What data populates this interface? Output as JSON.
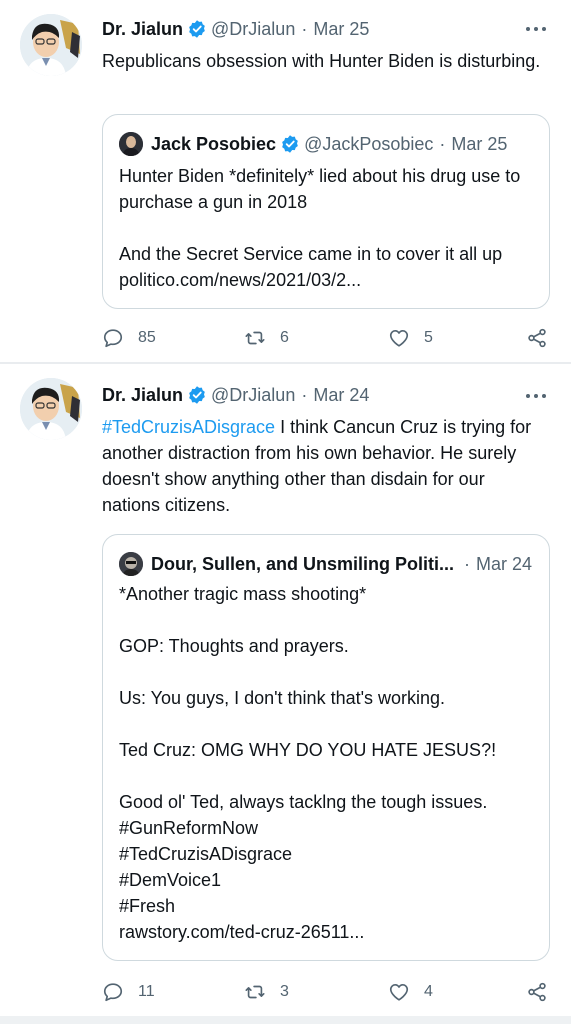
{
  "tweets": [
    {
      "author": {
        "name": "Dr. Jialun",
        "handle": "@DrJialun"
      },
      "date": "Mar 25",
      "text": "Republicans obsession with Hunter Biden is disturbing.",
      "quote": {
        "author": {
          "name": "Jack Posobiec",
          "handle": "@JackPosobiec"
        },
        "date": "Mar 25",
        "text": "Hunter Biden *definitely* lied about his drug use to purchase a gun in 2018\n\nAnd the Secret Service came in to cover it all up\npolitico.com/news/2021/03/2..."
      },
      "stats": {
        "replies": "85",
        "retweets": "6",
        "likes": "5"
      }
    },
    {
      "author": {
        "name": "Dr. Jialun",
        "handle": "@DrJialun"
      },
      "date": "Mar 24",
      "hashtag": "#TedCruzisADisgrace",
      "text": " I think Cancun Cruz is trying for another distraction from his own behavior. He surely doesn't show anything other than disdain for our nations citizens.",
      "quote": {
        "author": {
          "name": "Dour, Sullen, and Unsmiling Politi...",
          "handle": ""
        },
        "date": "Mar 24",
        "text": "*Another tragic mass shooting*\n\nGOP: Thoughts and prayers.\n\nUs: You guys, I don't think that's working.\n\nTed Cruz: OMG WHY DO YOU HATE JESUS?!\n\nGood ol' Ted, always tacklng the tough issues.\n#GunReformNow\n#TedCruzisADisgrace\n#DemVoice1\n#Fresh\nrawstory.com/ted-cruz-26511..."
      },
      "stats": {
        "replies": "11",
        "retweets": "3",
        "likes": "4"
      }
    }
  ],
  "icons": {
    "verified": "verified-badge-icon",
    "more": "more-dots-icon",
    "reply": "reply-bubble-icon",
    "retweet": "retweet-arrows-icon",
    "like": "heart-icon",
    "share": "share-nodes-icon"
  },
  "colors": {
    "accent": "#1d9bf0",
    "secondary_text": "#536471",
    "border": "#cfd9de"
  }
}
